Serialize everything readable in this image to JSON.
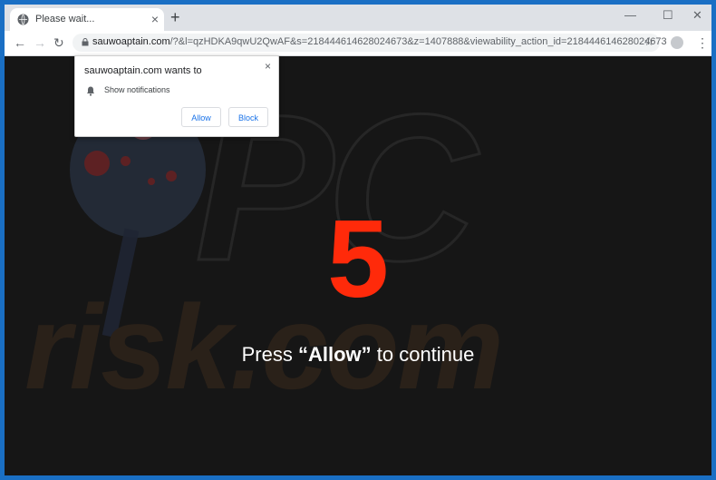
{
  "tab": {
    "title": "Please wait...",
    "close_glyph": "×"
  },
  "toolbar": {
    "new_tab_glyph": "+",
    "back_glyph": "←",
    "forward_glyph": "→",
    "reload_glyph": "↻",
    "url_host": "sauwoaptain.com",
    "url_rest": "/?&l=qzHDKA9qwU2QwAF&s=218444614628024673&z=1407888&viewability_action_id=218444614628024673",
    "star_glyph": "☆",
    "menu_glyph": "⋮"
  },
  "window_controls": {
    "minimize": "—",
    "maximize": "☐",
    "close": "✕"
  },
  "prompt": {
    "title": "sauwoaptain.com wants to",
    "permission": "Show notifications",
    "allow_label": "Allow",
    "block_label": "Block",
    "close_glyph": "×"
  },
  "page": {
    "countdown": "5",
    "cta_before": "Press ",
    "cta_bold": "“Allow”",
    "cta_after": " to continue"
  },
  "watermark": {
    "pc": "PC",
    "risk": "risk.com"
  },
  "colors": {
    "countdown": "#ff2a0a",
    "accent": "#1a73e8",
    "frame": "#1a6fc4"
  },
  "icons": {
    "tab_favicon": "globe-icon",
    "lock": "lock-icon",
    "bookmark": "star-icon",
    "notification": "bell-icon",
    "profile": "avatar-icon"
  }
}
